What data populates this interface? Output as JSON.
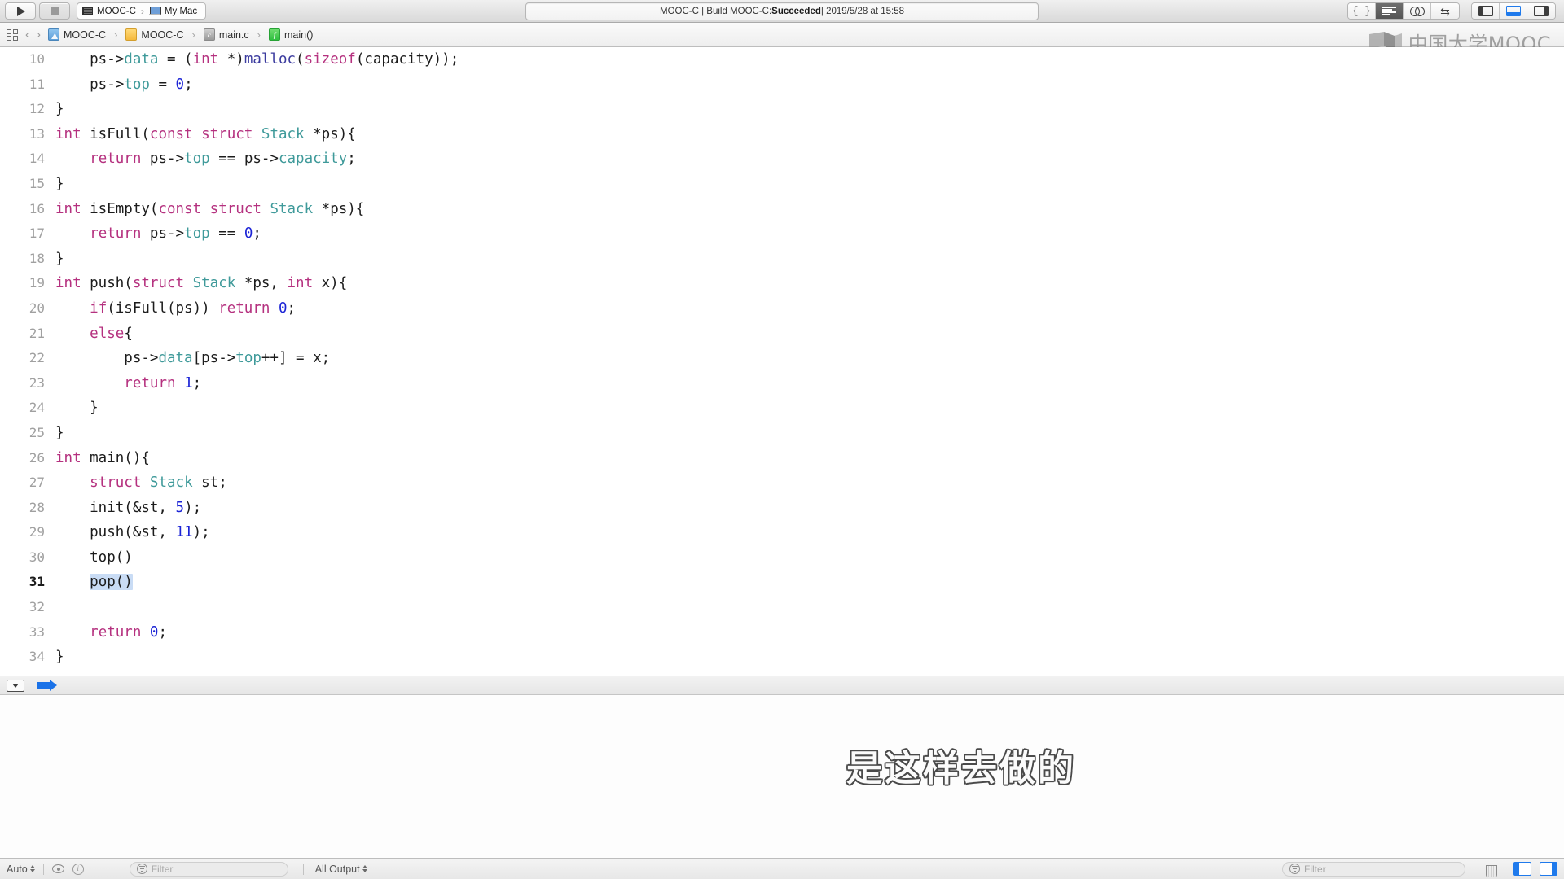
{
  "toolbar": {
    "run_label": "run-button",
    "stop_label": "stop-button",
    "scheme_target": "MOOC-C",
    "scheme_destination": "My Mac",
    "scheme_separator": "›",
    "status_prefix": "MOOC-C | Build MOOC-C: ",
    "status_result": "Succeeded",
    "status_suffix": " | 2019/5/28 at 15:58",
    "editor_modes": [
      {
        "name": "braces-editor",
        "glyph": "{}",
        "active": false
      },
      {
        "name": "standard-editor",
        "glyph": "lines",
        "active": true
      },
      {
        "name": "assistant-editor",
        "glyph": "venn",
        "active": false
      },
      {
        "name": "version-editor",
        "glyph": "⇄",
        "active": false
      }
    ],
    "panel_toggles": [
      {
        "name": "navigator-toggle",
        "side": "left",
        "active": false
      },
      {
        "name": "debug-area-toggle",
        "side": "bottom",
        "active": true
      },
      {
        "name": "utilities-toggle",
        "side": "right",
        "active": false
      }
    ]
  },
  "breadcrumb": {
    "grid_icon": "grid-icon",
    "back_icon": "‹",
    "forward_icon": "›",
    "separator": "›",
    "items": [
      {
        "label": "MOOC-C",
        "icon": "project-icon",
        "kind": "proj",
        "glyph": ""
      },
      {
        "label": "MOOC-C",
        "icon": "folder-icon",
        "kind": "folder",
        "glyph": ""
      },
      {
        "label": "main.c",
        "icon": "c-file-icon",
        "kind": "cfile",
        "glyph": "c"
      },
      {
        "label": "main()",
        "icon": "function-icon",
        "kind": "func",
        "glyph": "f"
      }
    ]
  },
  "watermark": {
    "text": "中国大学MOOC",
    "icon": "mooc-book-icon"
  },
  "editor": {
    "current_line": 31,
    "lines": [
      {
        "n": 10,
        "tokens": [
          {
            "t": "    ps->",
            "c": "pl"
          },
          {
            "t": "data",
            "c": "typ"
          },
          {
            "t": " = (",
            "c": "pl"
          },
          {
            "t": "int",
            "c": "kw"
          },
          {
            "t": " *)",
            "c": "pl"
          },
          {
            "t": "malloc",
            "c": "fn"
          },
          {
            "t": "(",
            "c": "pl"
          },
          {
            "t": "sizeof",
            "c": "kw"
          },
          {
            "t": "(capacity));",
            "c": "pl"
          }
        ]
      },
      {
        "n": 11,
        "tokens": [
          {
            "t": "    ps->",
            "c": "pl"
          },
          {
            "t": "top",
            "c": "typ"
          },
          {
            "t": " = ",
            "c": "pl"
          },
          {
            "t": "0",
            "c": "num"
          },
          {
            "t": ";",
            "c": "pl"
          }
        ]
      },
      {
        "n": 12,
        "tokens": [
          {
            "t": "}",
            "c": "pl"
          }
        ]
      },
      {
        "n": 13,
        "tokens": [
          {
            "t": "int",
            "c": "kw"
          },
          {
            "t": " isFull(",
            "c": "pl"
          },
          {
            "t": "const",
            "c": "kw"
          },
          {
            "t": " ",
            "c": "pl"
          },
          {
            "t": "struct",
            "c": "kw"
          },
          {
            "t": " ",
            "c": "pl"
          },
          {
            "t": "Stack",
            "c": "typ"
          },
          {
            "t": " *ps){",
            "c": "pl"
          }
        ]
      },
      {
        "n": 14,
        "tokens": [
          {
            "t": "    ",
            "c": "pl"
          },
          {
            "t": "return",
            "c": "kw"
          },
          {
            "t": " ps->",
            "c": "pl"
          },
          {
            "t": "top",
            "c": "typ"
          },
          {
            "t": " == ps->",
            "c": "pl"
          },
          {
            "t": "capacity",
            "c": "typ"
          },
          {
            "t": ";",
            "c": "pl"
          }
        ]
      },
      {
        "n": 15,
        "tokens": [
          {
            "t": "}",
            "c": "pl"
          }
        ]
      },
      {
        "n": 16,
        "tokens": [
          {
            "t": "int",
            "c": "kw"
          },
          {
            "t": " isEmpty(",
            "c": "pl"
          },
          {
            "t": "const",
            "c": "kw"
          },
          {
            "t": " ",
            "c": "pl"
          },
          {
            "t": "struct",
            "c": "kw"
          },
          {
            "t": " ",
            "c": "pl"
          },
          {
            "t": "Stack",
            "c": "typ"
          },
          {
            "t": " *ps){",
            "c": "pl"
          }
        ]
      },
      {
        "n": 17,
        "tokens": [
          {
            "t": "    ",
            "c": "pl"
          },
          {
            "t": "return",
            "c": "kw"
          },
          {
            "t": " ps->",
            "c": "pl"
          },
          {
            "t": "top",
            "c": "typ"
          },
          {
            "t": " == ",
            "c": "pl"
          },
          {
            "t": "0",
            "c": "num"
          },
          {
            "t": ";",
            "c": "pl"
          }
        ]
      },
      {
        "n": 18,
        "tokens": [
          {
            "t": "}",
            "c": "pl"
          }
        ]
      },
      {
        "n": 19,
        "tokens": [
          {
            "t": "int",
            "c": "kw"
          },
          {
            "t": " push(",
            "c": "pl"
          },
          {
            "t": "struct",
            "c": "kw"
          },
          {
            "t": " ",
            "c": "pl"
          },
          {
            "t": "Stack",
            "c": "typ"
          },
          {
            "t": " *ps, ",
            "c": "pl"
          },
          {
            "t": "int",
            "c": "kw"
          },
          {
            "t": " x){",
            "c": "pl"
          }
        ]
      },
      {
        "n": 20,
        "tokens": [
          {
            "t": "    ",
            "c": "pl"
          },
          {
            "t": "if",
            "c": "kw"
          },
          {
            "t": "(isFull(ps)) ",
            "c": "pl"
          },
          {
            "t": "return",
            "c": "kw"
          },
          {
            "t": " ",
            "c": "pl"
          },
          {
            "t": "0",
            "c": "num"
          },
          {
            "t": ";",
            "c": "pl"
          }
        ]
      },
      {
        "n": 21,
        "tokens": [
          {
            "t": "    ",
            "c": "pl"
          },
          {
            "t": "else",
            "c": "kw"
          },
          {
            "t": "{",
            "c": "pl"
          }
        ]
      },
      {
        "n": 22,
        "tokens": [
          {
            "t": "        ps->",
            "c": "pl"
          },
          {
            "t": "data",
            "c": "typ"
          },
          {
            "t": "[ps->",
            "c": "pl"
          },
          {
            "t": "top",
            "c": "typ"
          },
          {
            "t": "++] = x;",
            "c": "pl"
          }
        ]
      },
      {
        "n": 23,
        "tokens": [
          {
            "t": "        ",
            "c": "pl"
          },
          {
            "t": "return",
            "c": "kw"
          },
          {
            "t": " ",
            "c": "pl"
          },
          {
            "t": "1",
            "c": "num"
          },
          {
            "t": ";",
            "c": "pl"
          }
        ]
      },
      {
        "n": 24,
        "tokens": [
          {
            "t": "    }",
            "c": "pl"
          }
        ]
      },
      {
        "n": 25,
        "tokens": [
          {
            "t": "}",
            "c": "pl"
          }
        ]
      },
      {
        "n": 26,
        "tokens": [
          {
            "t": "int",
            "c": "kw"
          },
          {
            "t": " main(){",
            "c": "pl"
          }
        ]
      },
      {
        "n": 27,
        "tokens": [
          {
            "t": "    ",
            "c": "pl"
          },
          {
            "t": "struct",
            "c": "kw"
          },
          {
            "t": " ",
            "c": "pl"
          },
          {
            "t": "Stack",
            "c": "typ"
          },
          {
            "t": " st;",
            "c": "pl"
          }
        ]
      },
      {
        "n": 28,
        "tokens": [
          {
            "t": "    init(&st, ",
            "c": "pl"
          },
          {
            "t": "5",
            "c": "num"
          },
          {
            "t": ");",
            "c": "pl"
          }
        ]
      },
      {
        "n": 29,
        "tokens": [
          {
            "t": "    push(&st, ",
            "c": "pl"
          },
          {
            "t": "11",
            "c": "num"
          },
          {
            "t": ");",
            "c": "pl"
          }
        ]
      },
      {
        "n": 30,
        "tokens": [
          {
            "t": "    top()",
            "c": "pl"
          }
        ]
      },
      {
        "n": 31,
        "selected": true,
        "tokens": [
          {
            "t": "    ",
            "c": "pl"
          },
          {
            "t": "pop()",
            "c": "pl",
            "hl": true
          }
        ]
      },
      {
        "n": 32,
        "tokens": [
          {
            "t": "",
            "c": "pl"
          }
        ]
      },
      {
        "n": 33,
        "tokens": [
          {
            "t": "    ",
            "c": "pl"
          },
          {
            "t": "return",
            "c": "kw"
          },
          {
            "t": " ",
            "c": "pl"
          },
          {
            "t": "0",
            "c": "num"
          },
          {
            "t": ";",
            "c": "pl"
          }
        ]
      },
      {
        "n": 34,
        "tokens": [
          {
            "t": "}",
            "c": "pl"
          }
        ]
      }
    ]
  },
  "debug_bar": {
    "collapse_icon": "collapse-icon",
    "breakpoint_icon": "breakpoint-arrow-icon"
  },
  "subtitle": {
    "text": "是这样去做的"
  },
  "statusbar": {
    "scope_label": "Auto",
    "eye_icon": "eye-icon",
    "info_icon": "info-icon",
    "variables_filter_placeholder": "Filter",
    "output_label": "All Output",
    "console_filter_placeholder": "Filter",
    "trash_icon": "trash-icon",
    "split_left_icon": "split-left-icon",
    "split_right_icon": "split-right-icon"
  },
  "colors": {
    "keyword": "#b5317f",
    "type": "#3f9a9a",
    "number": "#1c24d6",
    "function": "#3a3a9e",
    "selection": "#c9dcf5",
    "accent_blue": "#1f7aec"
  }
}
